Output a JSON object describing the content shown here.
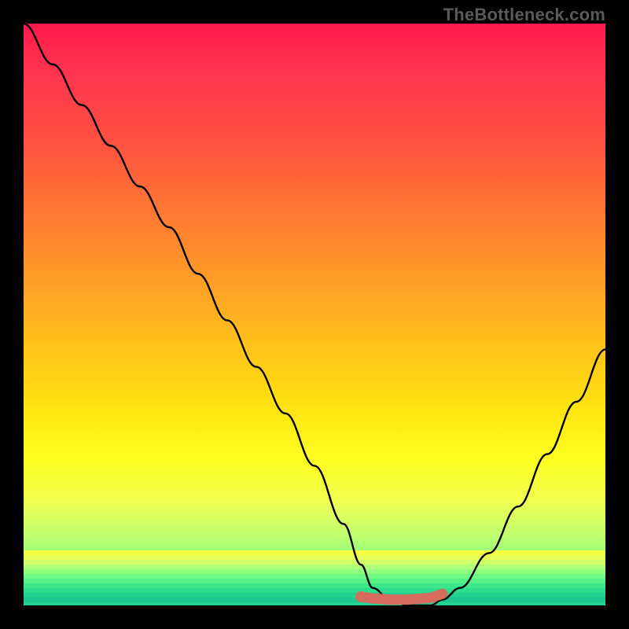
{
  "watermark": "TheBottleneck.com",
  "colors": {
    "background": "#000000",
    "gradient_top": "#ff1a4a",
    "gradient_mid": "#ffff20",
    "gradient_bottom": "#20d090",
    "curve": "#000000",
    "marker": "#d66b5e"
  },
  "chart_data": {
    "type": "line",
    "title": "",
    "xlabel": "",
    "ylabel": "",
    "xlim": [
      0,
      100
    ],
    "ylim": [
      0,
      100
    ],
    "annotations": [
      "TheBottleneck.com"
    ],
    "series": [
      {
        "name": "bottleneck-curve",
        "x": [
          0,
          5,
          10,
          15,
          20,
          25,
          30,
          35,
          40,
          45,
          50,
          55,
          58,
          60,
          63,
          66,
          70,
          72,
          75,
          80,
          85,
          90,
          95,
          100
        ],
        "y": [
          100,
          93,
          86,
          79,
          72,
          65,
          57,
          49,
          41,
          33,
          24,
          14,
          7,
          3,
          1,
          0,
          0,
          1,
          3,
          9,
          17,
          26,
          35,
          44
        ]
      },
      {
        "name": "optimal-marker",
        "x": [
          58,
          60,
          63,
          66,
          70,
          72
        ],
        "y": [
          1.5,
          1.2,
          1.0,
          1.0,
          1.3,
          2.0
        ]
      }
    ],
    "marker_dot": {
      "x": 58,
      "y": 1.5
    },
    "legend": "none",
    "grid": false
  }
}
